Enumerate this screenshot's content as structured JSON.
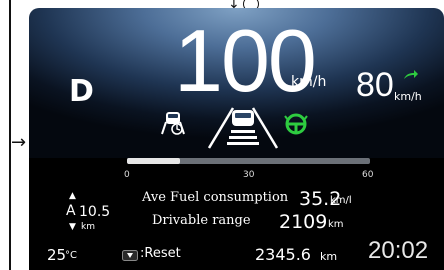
{
  "cluster": {
    "gear": "D",
    "speed": "100",
    "speed_unit": "km/h",
    "speed_limit": "80",
    "speed_limit_unit": "km/h",
    "gauge": {
      "ticks": [
        "0",
        "30",
        "60"
      ],
      "fill_fraction": 0.22
    },
    "trip": {
      "label": "A",
      "value": "10.5",
      "unit": "km"
    },
    "fuel_consumption": {
      "label": "Ave Fuel consumption",
      "value": "35.2",
      "unit": "km/l"
    },
    "drivable_range": {
      "label": "Drivable range",
      "value": "2109",
      "unit": "km"
    },
    "temperature": {
      "value": "25",
      "unit": "°C"
    },
    "reset_label": ":Reset",
    "odometer": {
      "value": "2345.6",
      "unit": "km"
    },
    "clock": "20:02"
  },
  "colors": {
    "accent_green": "#2ecc40",
    "sky_top": "#7fa1c4",
    "display_black": "#000000"
  },
  "icons": [
    "lane-keep-assist-icon",
    "adaptive-cruise-icon",
    "steering-assist-icon",
    "speed-limit-arrow-icon",
    "reset-button-icon"
  ]
}
